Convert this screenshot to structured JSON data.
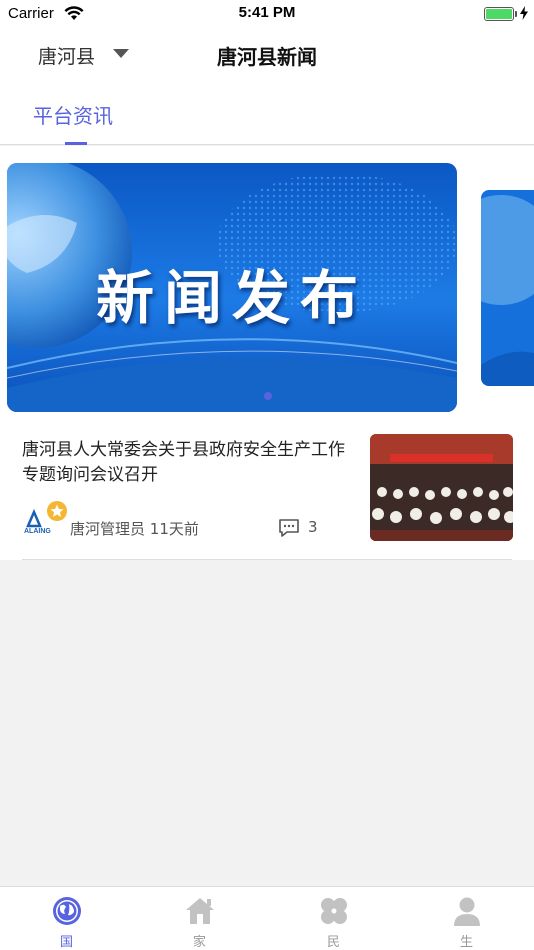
{
  "status_bar": {
    "carrier": "Carrier",
    "time": "5:41 PM",
    "battery_level": 1.0
  },
  "nav": {
    "county_selector": "唐河县",
    "title": "唐河县新闻"
  },
  "tabs": [
    {
      "label": "平台资讯",
      "active": true
    }
  ],
  "banner": {
    "text": "新闻发布",
    "page_count": 1,
    "current_page": 1
  },
  "articles": [
    {
      "headline": "唐河县人大常委会关于县政府安全生产工作专题询问会议召开",
      "author_badge_text": "ALAING",
      "author": "唐河管理员",
      "time_ago": "11天前",
      "comment_count": "3"
    }
  ],
  "tab_bar": [
    {
      "label": "国",
      "icon": "globe-icon",
      "active": true
    },
    {
      "label": "家",
      "icon": "house-icon",
      "active": false
    },
    {
      "label": "民",
      "icon": "clover-icon",
      "active": false
    },
    {
      "label": "生",
      "icon": "person-icon",
      "active": false
    }
  ],
  "colors": {
    "accent": "#5863e0",
    "inactive": "#c2c2c2",
    "battery": "#4cd964"
  }
}
